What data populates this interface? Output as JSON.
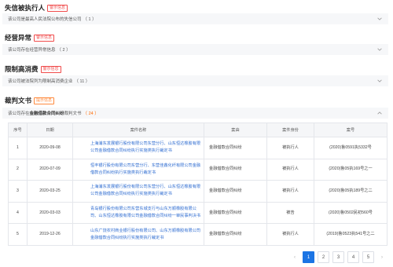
{
  "sections": [
    {
      "title": "失信被执行人",
      "tag": "警示信息",
      "bar_text": "该公司是最高人民法院公布的失信公司",
      "count": "（ 1 ）"
    },
    {
      "title": "经营异常",
      "tag": "警示信息",
      "bar_text": "该公司存在经营异常信息",
      "count": "（ 2 ）"
    },
    {
      "title": "限制高消费",
      "tag": "警示信息",
      "bar_text": "该公司被法院列为限制高消费企业",
      "count": "（ 11 ）"
    }
  ],
  "judgement": {
    "title": "裁判文书",
    "tag": "提示信息",
    "bar_prefix": "该公司存在",
    "bar_highlight": "金融借款合同纠纷",
    "bar_suffix": "裁判文书",
    "count": "（ 24 ）"
  },
  "table": {
    "headers": [
      "序号",
      "日期",
      "案件名称",
      "案由",
      "案件身份",
      "案号"
    ],
    "rows": [
      {
        "idx": "1",
        "date": "2020-09-08",
        "name": "上海浦东发展银行股份有限公司东营分行、山东恒达橡胶有限公司金融借款合同纠纷执行实施类执行裁定书",
        "cause": "金融借款合同纠纷",
        "role": "被执行人",
        "no": "(2020)鲁0591执5332号"
      },
      {
        "idx": "2",
        "date": "2020-07-09",
        "name": "恒丰银行股份有限公司东营分行、东营佳鑫化纤有限公司金融借款合同纠纷执行实施类执行裁定书",
        "cause": "金融借款合同纠纷",
        "role": "被执行人",
        "no": "(2020)鲁05执169号之一"
      },
      {
        "idx": "3",
        "date": "2020-03-25",
        "name": "上海浦东发展银行股份有限公司东营分行、山东恒达橡胶有限公司金融借款合同纠纷执行实施类执行裁定书",
        "cause": "金融借款合同纠纷",
        "role": "被执行人",
        "no": "(2020)鲁05执189号之二"
      },
      {
        "idx": "4",
        "date": "2020-03-03",
        "name": "青岛银行股份有限公司东营东城支行与山东万顺橡胶有限公司、山东恒达橡胶有限公司金融借款合同纠纷一审民事判决书",
        "cause": "金融借款合同纠纷",
        "role": "被告",
        "no": "(2020)鲁0502民初560号"
      },
      {
        "idx": "5",
        "date": "2019-12-26",
        "name": "山东广饶农村商业银行股份有限公司、山东万顺橡胶有限公司金融借款合同纠纷执行实施类执行裁定书",
        "cause": "金融借款合同纠纷",
        "role": "被执行人",
        "no": "(2019)鲁0523执541号之二"
      }
    ]
  },
  "pagination": {
    "prev": "‹",
    "pages": [
      "1",
      "2",
      "3",
      "4",
      "5"
    ],
    "next": "›",
    "current": "1"
  },
  "colors": {
    "link": "#2e6cd1",
    "accent": "#1b74e4",
    "warn_tag": "#f04b4b",
    "hint_tag": "#ff8a3d"
  }
}
